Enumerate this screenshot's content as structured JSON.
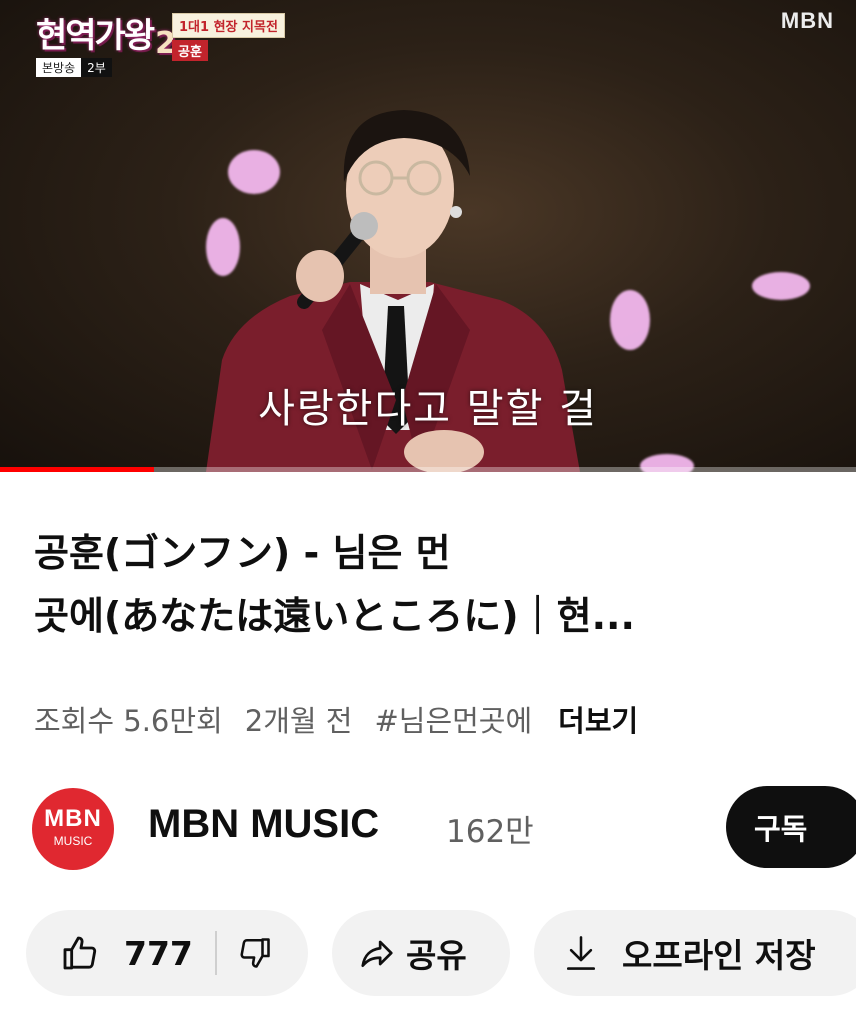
{
  "video": {
    "show_logo": "현역가왕",
    "show_logo_number": "2",
    "episode_left": "본방송",
    "episode_right": "2부",
    "tag_top": "1대1 현장 지목전",
    "tag_bottom": "공훈",
    "broadcaster": "MBN",
    "subtitle": "사랑한다고 말할 걸",
    "progress_fraction": 0.18
  },
  "info": {
    "title_line1": "공훈(ゴンフン) - 님은 먼",
    "title_line2": "곳에(あなたは遠いところに)｜현...",
    "views": "조회수 5.6만회",
    "age": "2개월 전",
    "hashtag": "#님은먼곳에",
    "more": "더보기"
  },
  "channel": {
    "avatar_line1": "MBN",
    "avatar_line2": "MUSIC",
    "name": "MBN MUSIC",
    "subscribers": "162만",
    "subscribe_label": "구독"
  },
  "actions": {
    "like_count": "777",
    "share_label": "공유",
    "save_label": "오프라인 저장"
  },
  "colors": {
    "accent_red": "#ff0000",
    "avatar_red": "#e02830",
    "pill_bg": "#f2f2f2"
  },
  "icons": [
    "thumbs-up-icon",
    "thumbs-down-icon",
    "share-icon",
    "download-icon"
  ]
}
